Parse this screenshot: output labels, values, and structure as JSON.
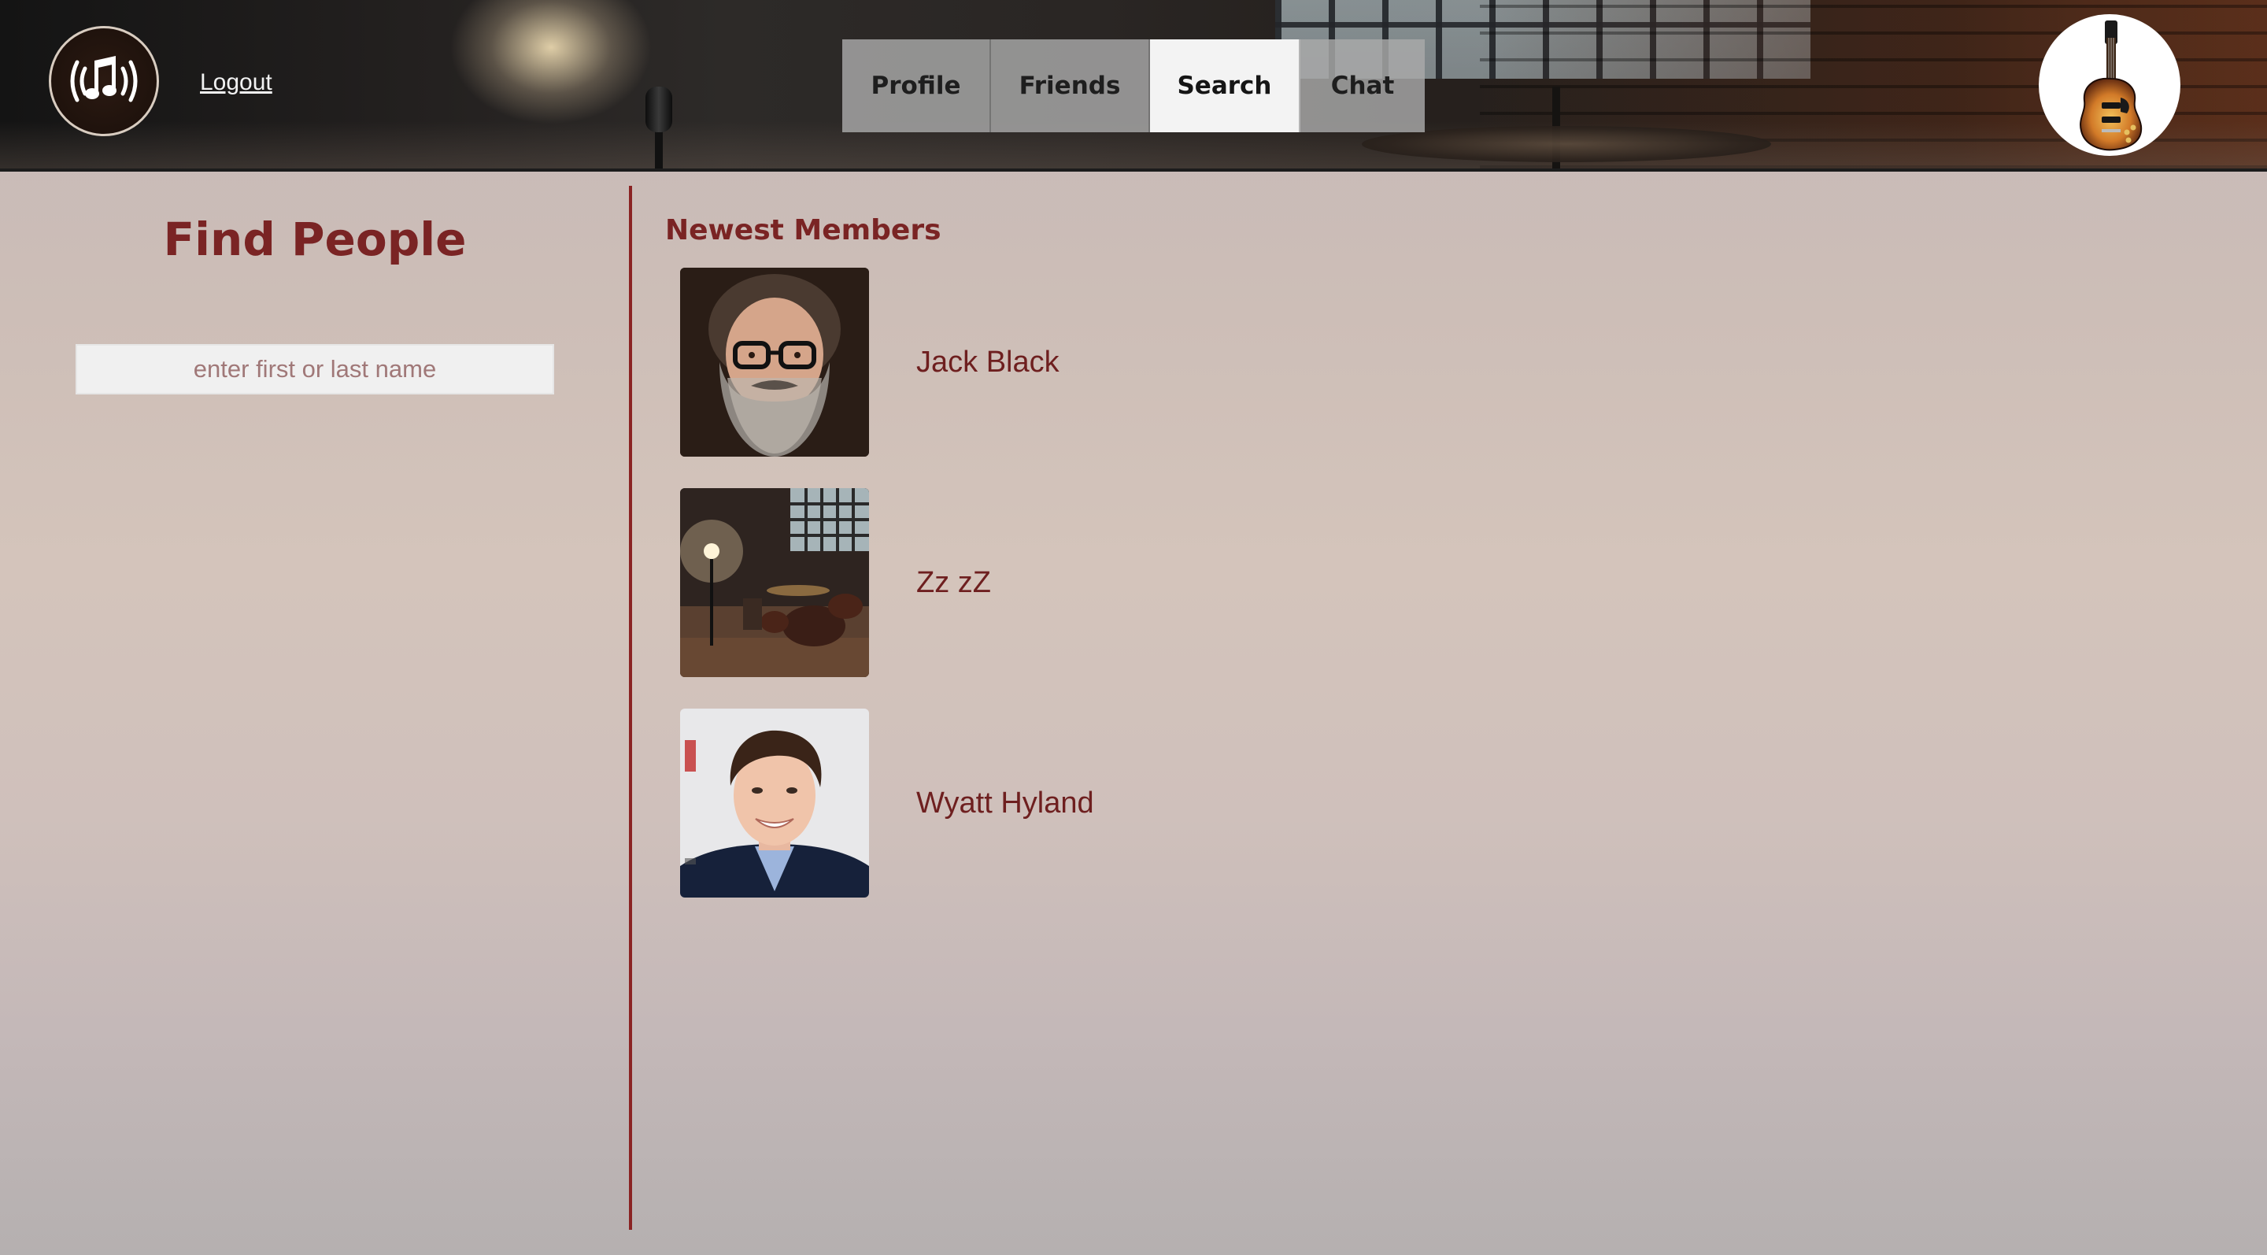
{
  "header": {
    "logo_icon": "music-note-broadcast-icon",
    "logout_label": "Logout",
    "avatar_icon": "guitar-icon"
  },
  "nav": {
    "tabs": [
      {
        "label": "Profile",
        "active": false
      },
      {
        "label": "Friends",
        "active": false
      },
      {
        "label": "Search",
        "active": true
      },
      {
        "label": "Chat",
        "active": false
      }
    ]
  },
  "search": {
    "title": "Find People",
    "placeholder": "enter first or last name",
    "value": ""
  },
  "members": {
    "title": "Newest Members",
    "list": [
      {
        "name": "Jack Black",
        "photo": "bearded-man-with-glasses"
      },
      {
        "name": "Zz zZ",
        "photo": "music-studio-room"
      },
      {
        "name": "Wyatt Hyland",
        "photo": "smiling-young-man"
      }
    ]
  },
  "colors": {
    "accent": "#7a2424",
    "divider": "#8a2323",
    "tab_bg": "#aaaaaa",
    "tab_active_bg": "#f3f3f3"
  }
}
